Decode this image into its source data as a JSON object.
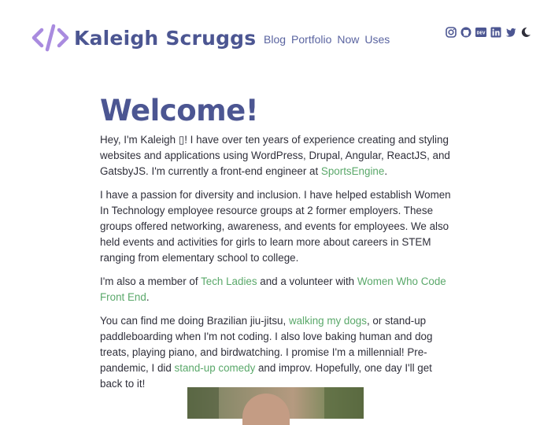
{
  "header": {
    "site_title": "Kaleigh Scruggs",
    "logo_icon": "code-brackets-icon",
    "nav": [
      {
        "label": "Blog"
      },
      {
        "label": "Portfolio"
      },
      {
        "label": "Now"
      },
      {
        "label": "Uses"
      }
    ],
    "social_icons": [
      "instagram-icon",
      "github-icon",
      "dev-icon",
      "linkedin-icon",
      "twitter-icon",
      "moon-icon"
    ],
    "colors": {
      "brand": "#4c5692",
      "logo_accent": "#a98bdf",
      "link": "#5aa86a"
    }
  },
  "main": {
    "heading": "Welcome!",
    "p1": {
      "t1": "Hey, I'm Kaleigh ",
      "emoji": "▯",
      "t2": "! I have over ten years of experience creating and styling websites and applications using WordPress, Drupal, Angular, ReactJS, and GatsbyJS. I'm currently a front-end engineer at ",
      "link": "SportsEngine",
      "t3": "."
    },
    "p2": "I have a passion for diversity and inclusion. I have helped establish Women In Technology employee resource groups at 2 former employers. These groups offered networking, awareness, and events for employees. We also held events and activities for girls to learn more about careers in STEM ranging from elementary school to college.",
    "p3": {
      "t1": "I'm also a member of ",
      "link1": "Tech Ladies",
      "t2": " and a volunteer with ",
      "link2": "Women Who Code Front End",
      "t3": "."
    },
    "p4": {
      "t1": "You can find me doing Brazilian jiu-jitsu, ",
      "link1": "walking my dogs",
      "t2": ", or stand-up paddleboarding when I'm not coding. I also love baking human and dog treats, playing piano, and birdwatching. I promise I'm a millennial! Pre-pandemic, I did ",
      "link2": "stand-up comedy",
      "t3": " and improv. Hopefully, one day I'll get back to it!"
    }
  }
}
